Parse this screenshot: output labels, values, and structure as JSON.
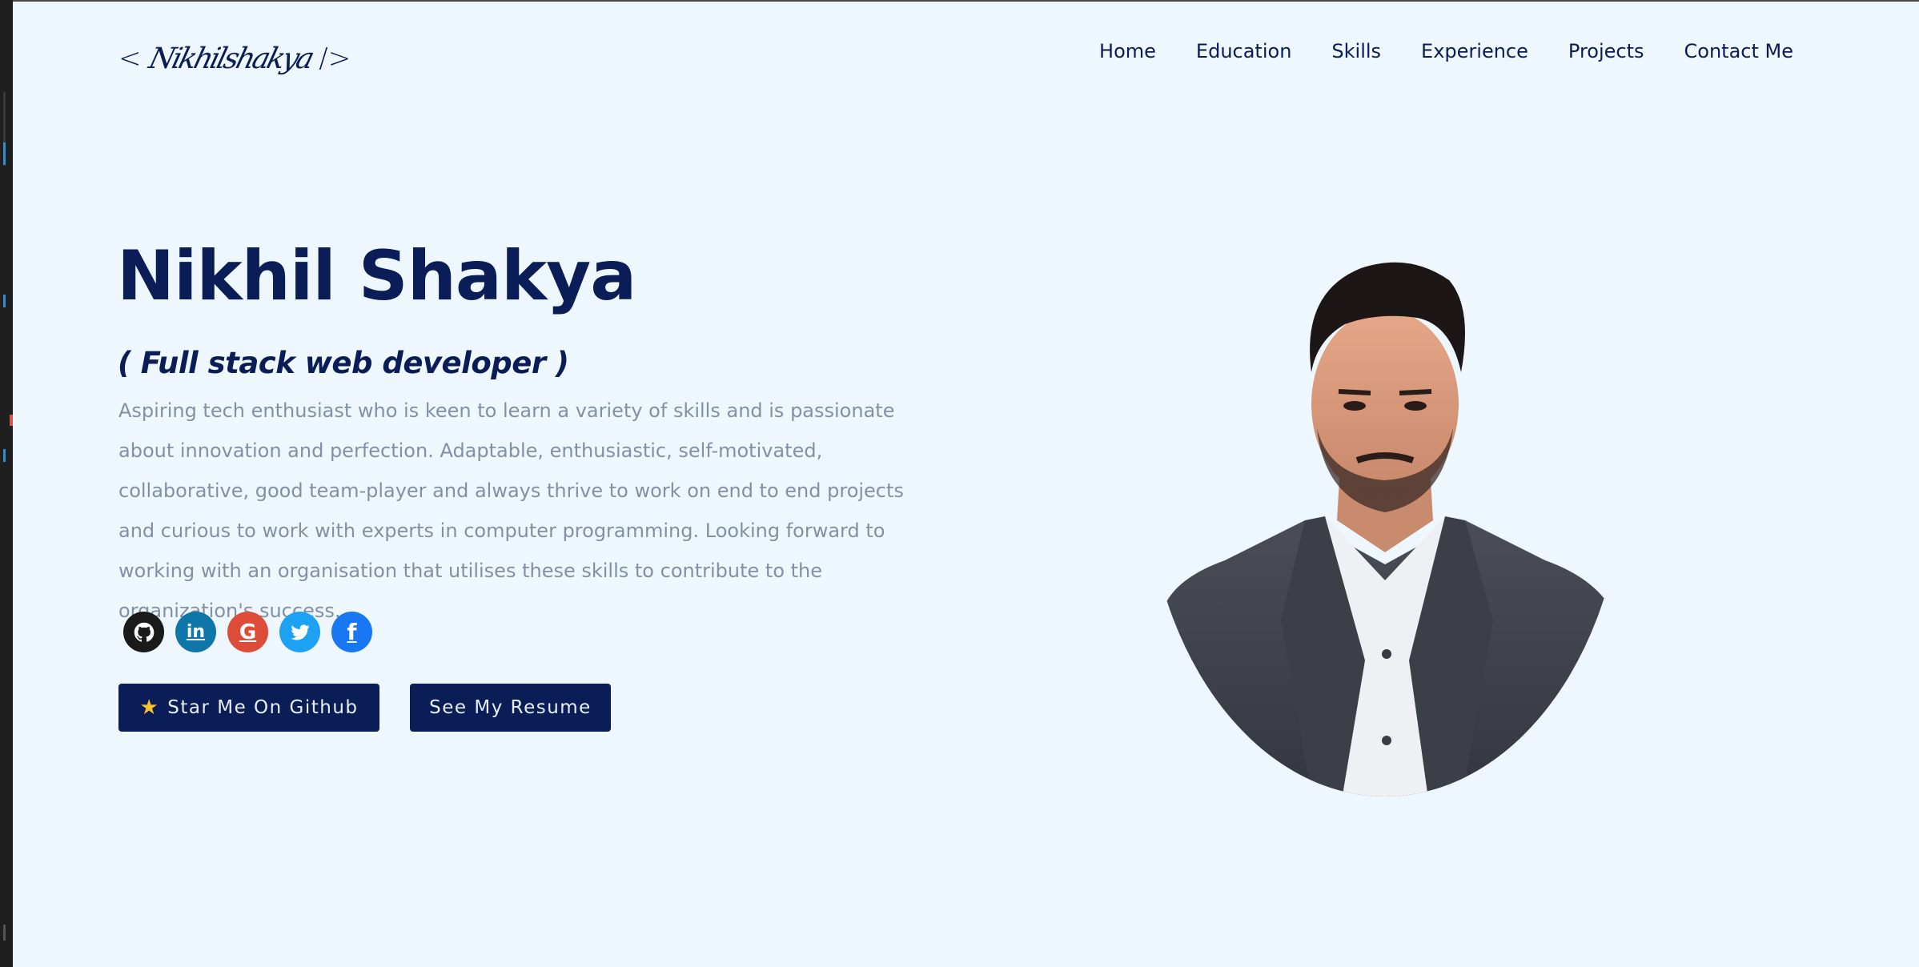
{
  "header": {
    "logo": {
      "open": "<",
      "signature": "Nikhilshakya",
      "close": "/>"
    },
    "nav": [
      {
        "label": "Home"
      },
      {
        "label": "Education"
      },
      {
        "label": "Skills"
      },
      {
        "label": "Experience"
      },
      {
        "label": "Projects"
      },
      {
        "label": "Contact Me"
      }
    ]
  },
  "hero": {
    "name": "Nikhil Shakya",
    "role": "( Full stack web developer )",
    "description": "Aspiring tech enthusiast who is keen to learn a variety of skills and is passionate about innovation and perfection. Adaptable, enthusiastic, self-motivated, collaborative, good team-player and always thrive to work on end to end projects and curious to work with experts in computer programming. Looking forward to working with an organisation that utilises these skills to contribute to the organization's success.",
    "socials": [
      {
        "icon": "github-icon",
        "glyph": "",
        "color": "#1a1a1a"
      },
      {
        "icon": "linkedin-icon",
        "glyph": "in",
        "color": "#0e76a8"
      },
      {
        "icon": "google-icon",
        "glyph": "G",
        "color": "#dd4b39"
      },
      {
        "icon": "twitter-icon",
        "glyph": "",
        "color": "#1da1f2"
      },
      {
        "icon": "facebook-icon",
        "glyph": "f",
        "color": "#1877f2"
      }
    ],
    "buttons": {
      "github": {
        "icon": "star-icon",
        "label": "Star Me On Github"
      },
      "resume": {
        "label": "See My Resume"
      }
    }
  },
  "colors": {
    "background": "#edf7fd",
    "primary": "#0a1d56",
    "muted_text": "#8290a6"
  }
}
